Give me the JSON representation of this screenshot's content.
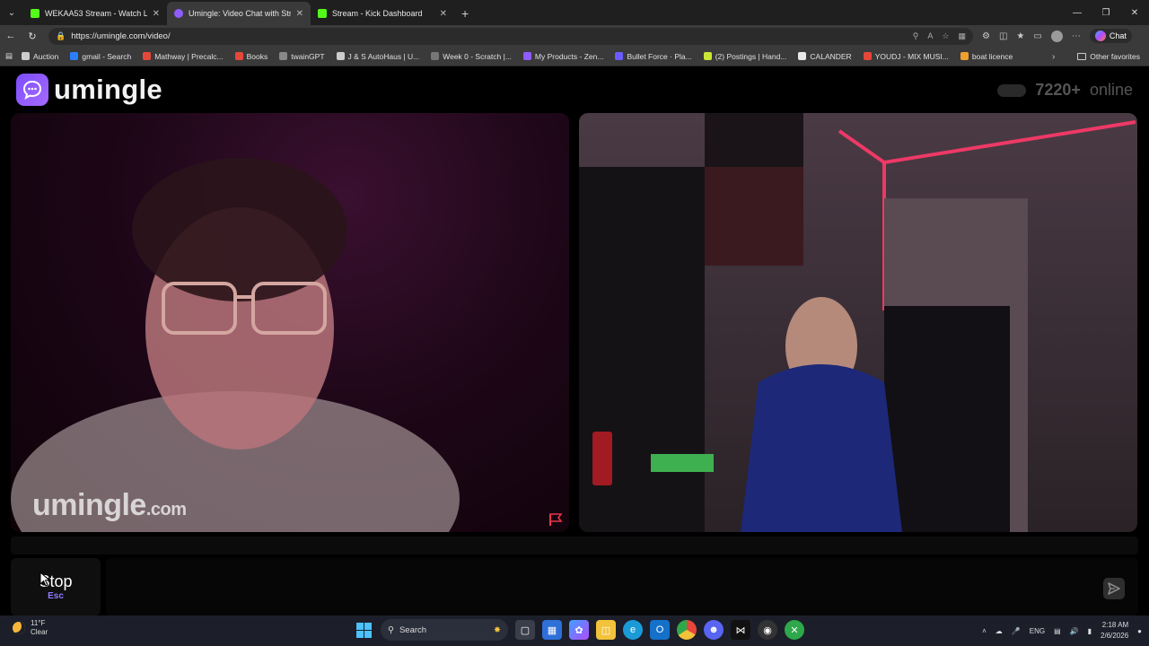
{
  "browser": {
    "tabs": [
      {
        "title": "WEKAA53 Stream - Watch Live on",
        "color": "#53fc18",
        "active": false
      },
      {
        "title": "Umingle: Video Chat with Str",
        "color": "#8e5cff",
        "active": true
      },
      {
        "title": "Stream - Kick Dashboard",
        "color": "#53fc18",
        "active": false
      }
    ],
    "url": "https://umingle.com/video/",
    "chat_label": "Chat",
    "bookmarks": [
      {
        "label": "Auction",
        "color": "#cccccc"
      },
      {
        "label": "gmail - Search",
        "color": "#2a7fff"
      },
      {
        "label": "Mathway | Precalc...",
        "color": "#e5483a"
      },
      {
        "label": "Books",
        "color": "#e5483a"
      },
      {
        "label": "twainGPT",
        "color": "#888888"
      },
      {
        "label": "J & S AutoHaus | U...",
        "color": "#cccccc"
      },
      {
        "label": "Week 0 - Scratch |...",
        "color": "#777777"
      },
      {
        "label": "My Products - Zen...",
        "color": "#8e5cff"
      },
      {
        "label": "Bullet Force · Pla...",
        "color": "#6b5cff"
      },
      {
        "label": "(2) Postings | Hand...",
        "color": "#c8e636"
      },
      {
        "label": "CALANDER",
        "color": "#e8e8e8"
      },
      {
        "label": "YOUDJ - MIX MUSI...",
        "color": "#e5483a"
      },
      {
        "label": "boat licence",
        "color": "#f0a030"
      }
    ],
    "other_favorites": "Other favorites"
  },
  "site": {
    "logo_text": "umingle",
    "online_count": "7220+",
    "online_label": "online",
    "watermark_main": "umingle",
    "watermark_suffix": ".com",
    "stop_label": "Stop",
    "stop_key": "Esc",
    "chat_placeholder": ""
  },
  "taskbar": {
    "weather_temp": "11°F",
    "weather_desc": "Clear",
    "search_label": "Search",
    "language": "ENG",
    "time": "2:18 AM",
    "date": "2/6/2026"
  }
}
